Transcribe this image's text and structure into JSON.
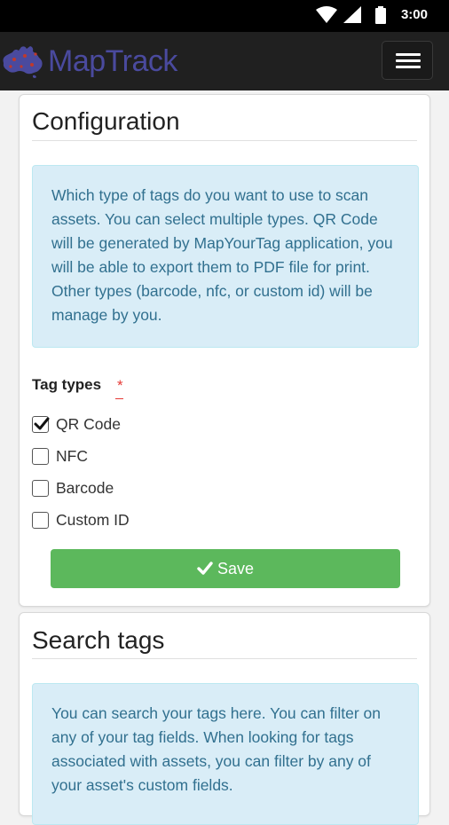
{
  "status_bar": {
    "time": "3:00",
    "icons": [
      "wifi-icon",
      "signal-icon",
      "battery-icon"
    ]
  },
  "app_bar": {
    "brand": "MapTrack",
    "logo_icon": "australia-map-icon",
    "menu_icon": "hamburger-menu-icon"
  },
  "configuration": {
    "title": "Configuration",
    "info": "Which type of tags do you want to use to scan assets. You can select multiple types. QR Code will be generated by MapYourTag application, you will be able to export them to PDF file for print. Other types (barcode, nfc, or custom id) will be manage by you.",
    "tag_types_label": "Tag types",
    "required_mark": "*",
    "options": [
      {
        "label": "QR Code",
        "checked": true
      },
      {
        "label": "NFC",
        "checked": false
      },
      {
        "label": "Barcode",
        "checked": false
      },
      {
        "label": "Custom ID",
        "checked": false
      }
    ],
    "save_label": "Save"
  },
  "search_tags": {
    "title": "Search tags",
    "info": "You can search your tags here. You can filter on any of your tag fields. When looking for tags associated with assets, you can filter by any of your asset's custom fields."
  },
  "colors": {
    "app_bar": "#202020",
    "brand_text": "#4a4a9e",
    "info_bg": "#d9edf7",
    "info_text": "#31708f",
    "save_button": "#5cb85c",
    "required": "#e53935"
  }
}
